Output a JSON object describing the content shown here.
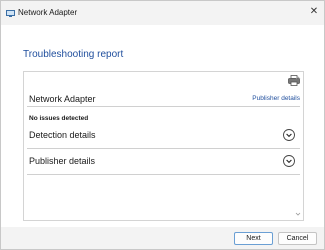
{
  "window": {
    "title": "Network Adapter",
    "close_glyph": "✕"
  },
  "page": {
    "heading": "Troubleshooting report"
  },
  "report": {
    "section_title": "Network Adapter",
    "publisher_link": "Publisher details",
    "status": "No issues detected",
    "rows": [
      {
        "label": "Detection details",
        "icon": "chevron-down-icon"
      },
      {
        "label": "Publisher details",
        "icon": "chevron-down-icon"
      }
    ]
  },
  "footer": {
    "next_label": "Next",
    "cancel_label": "Cancel"
  },
  "colors": {
    "accent": "#1f4e9d",
    "window_bg": "#f3f3f3",
    "content_bg": "#ffffff"
  }
}
